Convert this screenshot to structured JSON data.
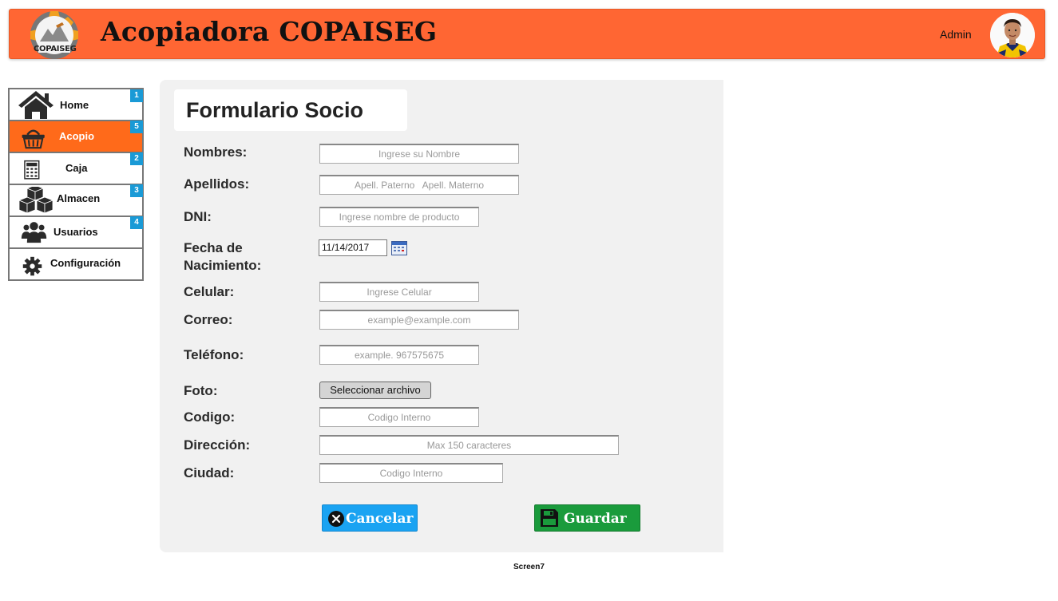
{
  "header": {
    "title": "Acopiadora COPAISEG",
    "logo_text": "COPAISEG",
    "user_name": "Admin",
    "brand_color": "#ff6633"
  },
  "sidebar": {
    "items": [
      {
        "label": "Home",
        "badge": "1",
        "icon": "home-icon",
        "active": false
      },
      {
        "label": "Acopio",
        "badge": "5",
        "icon": "basket-icon",
        "active": true
      },
      {
        "label": "Caja",
        "badge": "2",
        "icon": "calculator-icon",
        "active": false
      },
      {
        "label": "Almacen",
        "badge": "3",
        "icon": "boxes-icon",
        "active": false
      },
      {
        "label": "Usuarios",
        "badge": "4",
        "icon": "users-icon",
        "active": false
      },
      {
        "label": "Configuración",
        "badge": "",
        "icon": "gear-icon",
        "active": false
      }
    ],
    "active_color": "#ff6a1a",
    "badge_color": "#1a9ad6"
  },
  "form": {
    "title": "Formulario Socio",
    "fields": {
      "nombres": {
        "label": "Nombres:",
        "placeholder": "Ingrese su Nombre"
      },
      "apellidos": {
        "label": "Apellidos:",
        "placeholder": "Apell. Paterno   Apell. Materno"
      },
      "dni": {
        "label": "DNI:",
        "placeholder": "Ingrese nombre de producto"
      },
      "fecha": {
        "label_line1": "Fecha de",
        "label_line2": "Nacimiento:",
        "value": "11/14/2017"
      },
      "celular": {
        "label": "Celular:",
        "placeholder": "Ingrese Celular"
      },
      "correo": {
        "label": "Correo:",
        "placeholder": "example@example.com"
      },
      "telefono": {
        "label": "Teléfono:",
        "placeholder": "example. 967575675"
      },
      "foto": {
        "label": "Foto:",
        "button": "Seleccionar archivo"
      },
      "codigo": {
        "label": "Codigo:",
        "placeholder": "Codigo Interno"
      },
      "direccion": {
        "label": "Dirección:",
        "placeholder": "Max 150 caracteres"
      },
      "ciudad": {
        "label": "Ciudad:",
        "placeholder": "Codigo Interno"
      }
    },
    "buttons": {
      "cancel": {
        "label": "Cancelar",
        "icon": "close-icon",
        "color": "#1aa3f2"
      },
      "save": {
        "label": "Guardar",
        "icon": "save-icon",
        "color": "#1a9b3c"
      }
    }
  },
  "footer": {
    "screen_label": "Screen7"
  }
}
